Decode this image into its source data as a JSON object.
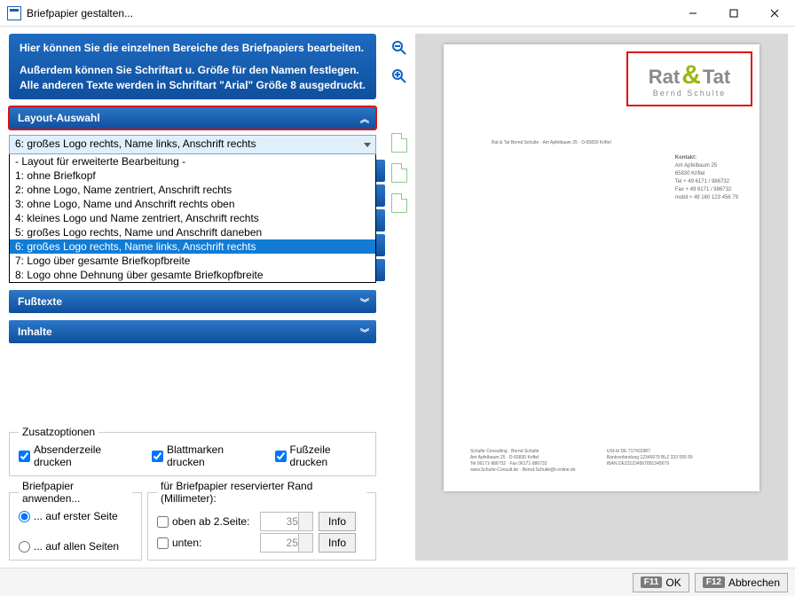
{
  "window": {
    "title": "Briefpapier gestalten..."
  },
  "help": {
    "line1": "Hier können Sie die einzelnen Bereiche des Briefpapiers bearbeiten.",
    "line2": "Außerdem können Sie Schriftart u. Größe für den Namen festlegen.",
    "line3": "Alle anderen Texte werden in Schriftart \"Arial\" Größe 8 ausgedruckt."
  },
  "accordion": {
    "layout": "Layout-Auswahl",
    "footer": "Fußtexte",
    "content": "Inhalte"
  },
  "layout_select": {
    "value": "6: großes Logo rechts, Name links, Anschrift rechts",
    "options": [
      "- Layout für erweiterte Bearbeitung -",
      "1: ohne Briefkopf",
      "2: ohne Logo, Name zentriert, Anschrift rechts",
      "3: ohne Logo, Name und Anschrift rechts oben",
      "4: kleines Logo und Name zentriert, Anschrift rechts",
      "5: großes Logo rechts, Name und Anschrift daneben",
      "6: großes Logo rechts, Name links, Anschrift rechts",
      "7: Logo über gesamte Briefkopfbreite",
      "8: Logo ohne Dehnung über gesamte Briefkopfbreite"
    ],
    "selected_index": 6
  },
  "extras": {
    "legend": "Zusatzoptionen",
    "sender": "Absenderzeile drucken",
    "marks": "Blattmarken drucken",
    "footer": "Fußzeile drucken"
  },
  "apply": {
    "legend": "Briefpapier anwenden...",
    "first": "... auf erster Seite",
    "all": "... auf allen Seiten"
  },
  "margin": {
    "legend": "für Briefpapier reservierter Rand (Millimeter):",
    "top_label": "oben ab 2.Seite:",
    "top_value": "35",
    "bottom_label": "unten:",
    "bottom_value": "25",
    "info": "Info"
  },
  "preview": {
    "logo_line1a": "Rat",
    "logo_line1b": "Tat",
    "logo_line2": "Bernd Schulte",
    "sender": "Rat & Tat Bernd Schulte · Am Apfelbaum 25 · D-65830 Kriftel",
    "kontakt_h": "Kontakt:",
    "k1": "Am Apfelbaum 25",
    "k2": "65830 Kriftel",
    "k3": "Tel + 49 6171 / 986732",
    "k4": "Fax + 49 6171 / 986732",
    "k5": "mobil + 49 160 123 456 79",
    "f1a": "Schulte Consulting · Bernd Schulte",
    "f1b": "Am Apfelbaum 25 · D-65830 Kriftel",
    "f1c": "Tel 06171-986732 · Fax 06171-986732",
    "f1d": "www.Schulte-Consult.de · Bernd.Schulte@t-online.de",
    "f2a": "USt-Id DE 717432987",
    "f2b": "Bankverbindung 12345679 BLZ 333 555 55",
    "f2c": "IBAN DE231234567891345679"
  },
  "buttons": {
    "ok_key": "F11",
    "ok": "OK",
    "cancel_key": "F12",
    "cancel": "Abbrechen"
  }
}
